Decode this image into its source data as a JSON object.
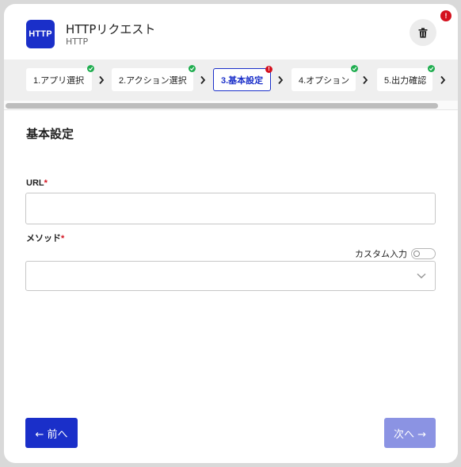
{
  "header": {
    "icon_text": "HTTP",
    "title": "HTTPリクエスト",
    "subtitle": "HTTP",
    "alert_mark": "!"
  },
  "steps": [
    {
      "label": "1.アプリ選択",
      "status": "done"
    },
    {
      "label": "2.アクション選択",
      "status": "done"
    },
    {
      "label": "3.基本設定",
      "status": "error"
    },
    {
      "label": "4.オプション",
      "status": "done"
    },
    {
      "label": "5.出力確認",
      "status": "done"
    }
  ],
  "section_title": "基本設定",
  "url_field": {
    "label": "URL",
    "required_mark": "*",
    "value": ""
  },
  "method_field": {
    "label": "メソッド",
    "required_mark": "*",
    "selected": ""
  },
  "custom_input": {
    "label": "カスタム入力",
    "enabled": false
  },
  "buttons": {
    "prev": "← 前へ",
    "next": "次へ →"
  },
  "colors": {
    "primary": "#1a2fc9",
    "primary_disabled": "#8b93e3",
    "error": "#d4111e",
    "success": "#1fad4f"
  },
  "icons": [
    "trash-icon",
    "chevron-right-icon",
    "chevron-down-icon",
    "check-icon"
  ]
}
